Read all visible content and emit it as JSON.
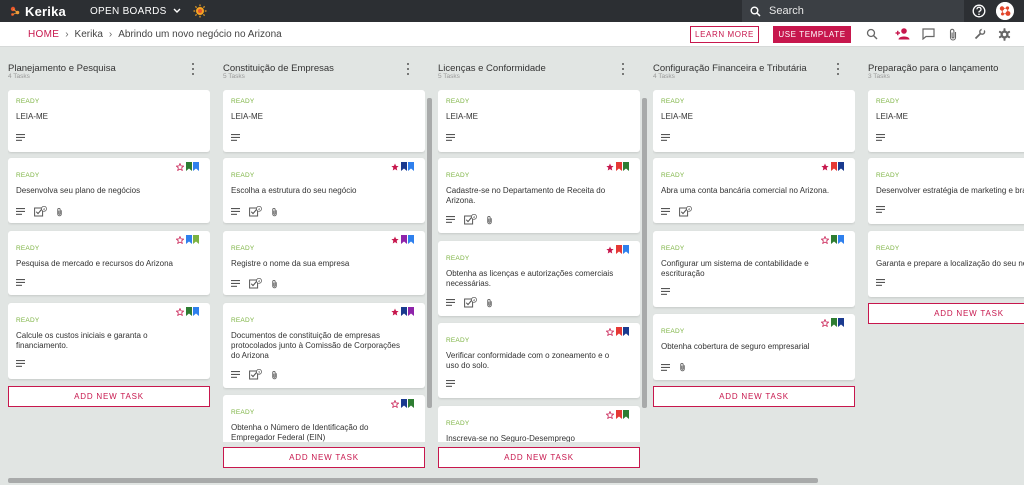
{
  "app": {
    "name": "Kerika",
    "open_boards": "OPEN BOARDS"
  },
  "search": {
    "placeholder": "Search"
  },
  "breadcrumb": {
    "home": "HOME",
    "org": "Kerika",
    "board": "Abrindo um novo negócio no Arizona"
  },
  "buttons": {
    "learn_more": "LEARN MORE",
    "use_template": "USE TEMPLATE"
  },
  "colors": {
    "accent": "#c7174d",
    "ready": "#7cb342",
    "topbar": "#2c2f33",
    "board_bg": "#e1e5e3"
  },
  "columns": [
    {
      "title": "Planejamento e Pesquisa",
      "count": "4 Tasks",
      "add": "ADD NEW TASK",
      "cards": [
        {
          "status": "READY",
          "title": "LEIA-ME",
          "icons": [
            "description-icon"
          ],
          "tags": []
        },
        {
          "status": "READY",
          "title": "Desenvolva seu plano de negócios",
          "icons": [
            "description-icon",
            "checklist-icon",
            "attachment-icon"
          ],
          "checklist_count": "4",
          "tags": [
            "star-outline",
            "green",
            "blue"
          ]
        },
        {
          "status": "READY",
          "title": "Pesquisa de mercado e recursos do Arizona",
          "icons": [
            "description-icon"
          ],
          "tags": [
            "star-outline",
            "blue",
            "lime"
          ]
        },
        {
          "status": "READY",
          "title": "Calcule os custos iniciais e garanta o financiamento.",
          "icons": [
            "description-icon"
          ],
          "tags": [
            "star-outline",
            "green",
            "blue"
          ]
        }
      ]
    },
    {
      "title": "Constituição de Empresas",
      "count": "5 Tasks",
      "add": "ADD NEW TASK",
      "cards": [
        {
          "status": "READY",
          "title": "LEIA-ME",
          "icons": [
            "description-icon"
          ],
          "tags": []
        },
        {
          "status": "READY",
          "title": "Escolha a estrutura do seu negócio",
          "icons": [
            "description-icon",
            "checklist-icon",
            "attachment-icon"
          ],
          "checklist_count": "4",
          "tags": [
            "star-filled",
            "navy",
            "blue"
          ]
        },
        {
          "status": "READY",
          "title": "Registre o nome da sua empresa",
          "icons": [
            "description-icon",
            "checklist-icon",
            "attachment-icon"
          ],
          "checklist_count": "4",
          "tags": [
            "star-filled",
            "purple",
            "blue"
          ]
        },
        {
          "status": "READY",
          "title": "Documentos de constituição de empresas protocolados junto à Comissão de Corporações do Arizona",
          "icons": [
            "description-icon",
            "checklist-icon",
            "attachment-icon"
          ],
          "checklist_count": "3",
          "tags": [
            "star-filled",
            "navy",
            "purple"
          ]
        },
        {
          "status": "READY",
          "title": "Obtenha o Número de Identificação do Empregador Federal (EIN)",
          "icons": [],
          "tags": [
            "star-outline",
            "navy",
            "green"
          ]
        }
      ]
    },
    {
      "title": "Licenças e Conformidade",
      "count": "5 Tasks",
      "add": "ADD NEW TASK",
      "cards": [
        {
          "status": "READY",
          "title": "LEIA-ME",
          "icons": [
            "description-icon"
          ],
          "tags": []
        },
        {
          "status": "READY",
          "title": "Cadastre-se no Departamento de Receita do Arizona.",
          "icons": [
            "description-icon",
            "checklist-icon",
            "attachment-icon"
          ],
          "checklist_count": "4",
          "tags": [
            "star-filled",
            "red",
            "green"
          ]
        },
        {
          "status": "READY",
          "title": "Obtenha as licenças e autorizações comerciais necessárias.",
          "icons": [
            "description-icon",
            "checklist-icon",
            "attachment-icon"
          ],
          "checklist_count": "4",
          "tags": [
            "star-filled",
            "red",
            "blue"
          ]
        },
        {
          "status": "READY",
          "title": "Verificar conformidade com o zoneamento e o uso do solo.",
          "icons": [
            "description-icon"
          ],
          "tags": [
            "star-outline",
            "red",
            "navy"
          ]
        },
        {
          "status": "READY",
          "title": "Inscreva-se no Seguro-Desemprego",
          "icons": [],
          "tags": [
            "star-outline",
            "red",
            "green"
          ]
        }
      ]
    },
    {
      "title": "Configuração Financeira e Tributária",
      "count": "4 Tasks",
      "add": "ADD NEW TASK",
      "cards": [
        {
          "status": "READY",
          "title": "LEIA-ME",
          "icons": [
            "description-icon"
          ],
          "tags": []
        },
        {
          "status": "READY",
          "title": "Abra uma conta bancária comercial no Arizona.",
          "icons": [
            "description-icon",
            "checklist-icon"
          ],
          "checklist_count": "4",
          "tags": [
            "star-filled",
            "red",
            "navy"
          ]
        },
        {
          "status": "READY",
          "title": "Configurar um sistema de contabilidade e escrituração",
          "icons": [
            "description-icon"
          ],
          "tags": [
            "star-outline",
            "green",
            "blue"
          ]
        },
        {
          "status": "READY",
          "title": "Obtenha cobertura de seguro empresarial",
          "icons": [
            "description-icon",
            "attachment-icon"
          ],
          "tags": [
            "star-outline",
            "green",
            "navy"
          ]
        }
      ]
    },
    {
      "title": "Preparação para o lançamento",
      "count": "3 Tasks",
      "add": "ADD NEW TASK",
      "cards": [
        {
          "status": "READY",
          "title": "LEIA-ME",
          "icons": [
            "description-icon"
          ],
          "tags": []
        },
        {
          "status": "READY",
          "title": "Desenvolver estratégia de marketing e branding",
          "icons": [
            "description-icon"
          ],
          "tags": []
        },
        {
          "status": "READY",
          "title": "Garanta e prepare a localização do seu negócio",
          "icons": [
            "description-icon"
          ],
          "tags": []
        }
      ]
    }
  ]
}
